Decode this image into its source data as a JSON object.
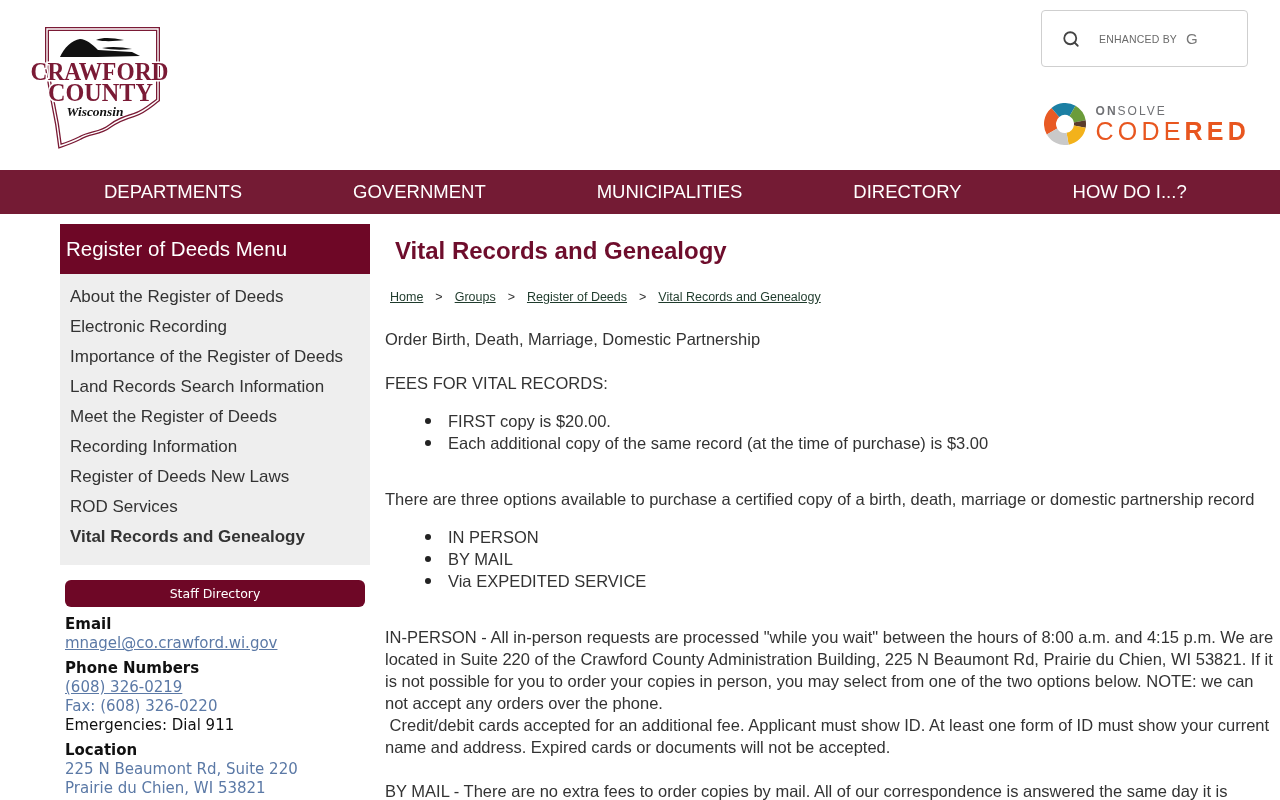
{
  "header": {
    "logo": {
      "line_1": "CRAWFORD",
      "line_2": "COUNTY",
      "line_3": "Wisconsin"
    },
    "search": {
      "label": "ENHANCED BY",
      "brand_mark": "G"
    },
    "alert_logo": {
      "line_1": "**ON**SOLVE",
      "line_2": "CODE**RED**"
    }
  },
  "nav": {
    "items": [
      "DEPARTMENTS",
      "GOVERNMENT",
      "MUNICIPALITIES",
      "DIRECTORY",
      "HOW DO I...?"
    ]
  },
  "sidebar": {
    "title": "Register of Deeds Menu",
    "items": [
      {
        "label": "About the Register of Deeds",
        "selected": false
      },
      {
        "label": "Electronic Recording",
        "selected": false
      },
      {
        "label": "Importance of the Register of Deeds",
        "selected": false
      },
      {
        "label": "Land Records Search Information",
        "selected": false
      },
      {
        "label": "Meet the Register of Deeds",
        "selected": false
      },
      {
        "label": "Recording Information",
        "selected": false
      },
      {
        "label": "Register of Deeds New Laws",
        "selected": false
      },
      {
        "label": "ROD Services",
        "selected": false
      },
      {
        "label": "Vital Records and Genealogy",
        "selected": true
      }
    ],
    "staff_directory_button": "Staff Directory",
    "contact": [
      {
        "heading": "Email",
        "lines": [
          {
            "kind": "link",
            "text": "mnagel@co.crawford.wi.gov"
          }
        ]
      },
      {
        "heading": "Phone Numbers",
        "lines": [
          {
            "kind": "link",
            "text": "(608) 326-0219"
          },
          {
            "kind": "info",
            "text": "Fax: (608) 326-0220"
          },
          {
            "kind": "plain",
            "text": "Emergencies: Dial 911"
          }
        ]
      },
      {
        "heading": "Location",
        "lines": [
          {
            "kind": "info",
            "text": "225 N Beaumont Rd, Suite 220"
          },
          {
            "kind": "info",
            "text": "Prairie du Chien, WI 53821"
          }
        ]
      }
    ]
  },
  "main": {
    "title": "Vital Records and Genealogy",
    "breadcrumb": {
      "separator": ">",
      "items": [
        "Home",
        "Groups",
        "Register of Deeds",
        "Vital Records and Genealogy"
      ]
    },
    "content": [
      {
        "kind": "paragraph",
        "text": "Order Birth, Death, Marriage, Domestic Partnership"
      },
      {
        "kind": "paragraph",
        "text": "FEES FOR VITAL RECORDS:"
      },
      {
        "kind": "list",
        "items": [
          "FIRST copy is $20.00.",
          "Each additional copy of the same record (at the time of purchase) is $3.00"
        ]
      },
      {
        "kind": "paragraph",
        "text": "There are three options available to purchase a certified copy of a birth, death, marriage or domestic partnership record"
      },
      {
        "kind": "list",
        "items": [
          "IN PERSON",
          "BY MAIL",
          "Via EXPEDITED SERVICE"
        ]
      },
      {
        "kind": "paragraph",
        "text": "IN-PERSON - All in-person requests are processed \"while you wait\" between the hours of 8:00 a.m. and 4:15 p.m. We are located in Suite 220 of the Crawford County Administration Building, 225 N Beaumont Rd, Prairie du Chien, WI 53821. If it is not possible for you to order your copies in person, you may select from one of the two options below. NOTE: we can not accept any orders over the phone.\n Credit/debit cards accepted for an additional fee. Applicant must show ID. At least one form of ID must show your current name and address. Expired cards or documents will not be accepted."
      },
      {
        "kind": "paragraph",
        "text": "BY MAIL - There are no extra fees to order copies by mail. All of our correspondence is answered the same day it is"
      }
    ]
  }
}
